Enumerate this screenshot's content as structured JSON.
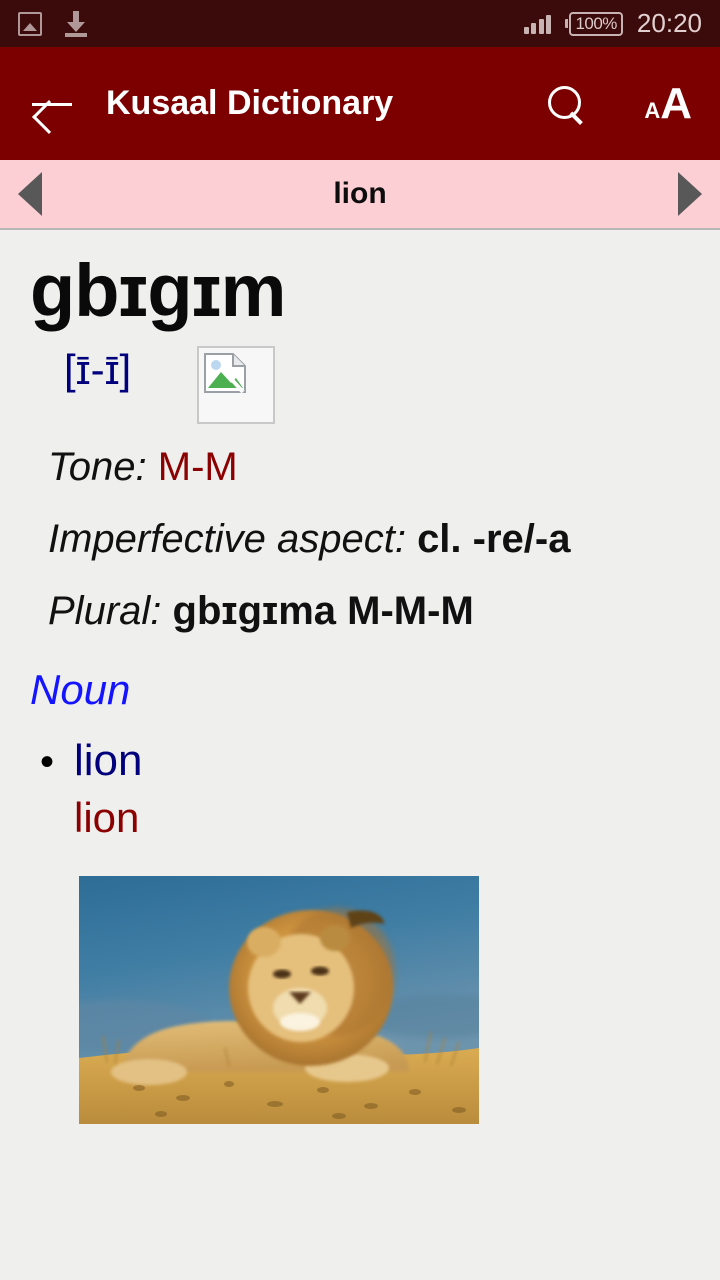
{
  "status_bar": {
    "icons": [
      "gallery-icon",
      "download-icon",
      "signal-icon"
    ],
    "battery": "100%",
    "time": "20:20"
  },
  "app_bar": {
    "back_icon": "back-arrow-icon",
    "title": "Kusaal Dictionary",
    "search_icon": "search-icon",
    "font_size_icon_small": "A",
    "font_size_icon_large": "A"
  },
  "nav_bar": {
    "prev_icon": "triangle-left-icon",
    "entry_title": "lion",
    "next_icon": "triangle-right-icon"
  },
  "entry": {
    "headword": "gbɪgɪm",
    "pronunciation": "[ɪ̄-ɪ̄]",
    "image_placeholder": "broken-image-icon",
    "fields": [
      {
        "label": "Tone:",
        "value": "M-M",
        "value_style": "red"
      },
      {
        "label": "Imperfective aspect:",
        "value": "cl. -re/-a",
        "value_style": "bold"
      },
      {
        "label": "Plural:",
        "value": "gbɪgɪma M-M-M",
        "value_style": "bold"
      }
    ],
    "part_of_speech": "Noun",
    "senses": [
      {
        "bullet": "•",
        "gloss": "lion",
        "gloss_english": "lion"
      }
    ],
    "photo_caption": "lion-photograph"
  },
  "colors": {
    "status_bar_bg": "#3b0a0a",
    "app_bar_bg": "#7d0000",
    "nav_bar_bg": "#fccfd4",
    "body_bg": "#efefee",
    "accent_navy": "#00007c",
    "accent_red": "#8b0000",
    "accent_blue": "#1414ff"
  }
}
